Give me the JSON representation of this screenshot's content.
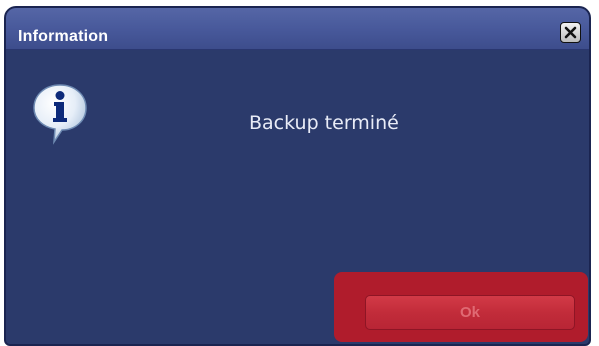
{
  "dialog": {
    "title": "Information",
    "message": "Backup terminé",
    "ok_label": "Ok"
  },
  "icons": {
    "close": "close-icon",
    "info": "info-icon"
  },
  "colors": {
    "dialog_bg": "#2b3a6b",
    "titlebar_bg": "#47589a",
    "ok_button": "#c22c3a",
    "highlight": "#b01c2c"
  }
}
